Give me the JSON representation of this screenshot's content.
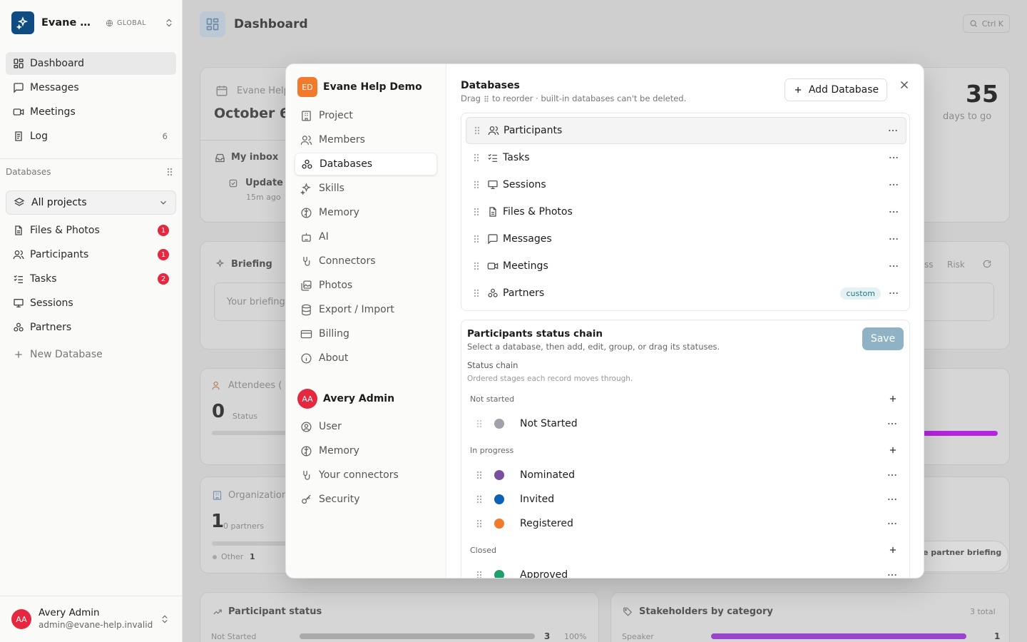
{
  "workspace": {
    "name": "Evane Help Demo",
    "scope": "GLOBAL"
  },
  "sidebar": {
    "nav": [
      {
        "label": "Dashboard"
      },
      {
        "label": "Messages"
      },
      {
        "label": "Meetings"
      },
      {
        "label": "Log",
        "count": "6"
      }
    ],
    "section_label": "Databases",
    "project_select": "All projects",
    "databases": [
      {
        "label": "Files & Photos",
        "badge": "1"
      },
      {
        "label": "Participants",
        "badge": "1"
      },
      {
        "label": "Tasks",
        "badge": "2"
      },
      {
        "label": "Sessions"
      },
      {
        "label": "Partners"
      }
    ],
    "new_database": "New Database"
  },
  "user": {
    "initials": "AA",
    "name": "Avery Admin",
    "email": "admin@evane-help.invalid"
  },
  "page": {
    "title": "Dashboard",
    "shortcut": "Ctrl K"
  },
  "background": {
    "event_name": "Evane Help",
    "event_date": "October 6",
    "days_count": "35",
    "days_label": "days to go",
    "inbox_title": "My inbox",
    "inbox_item": "Update",
    "inbox_time": "15m ago",
    "briefing_title": "Briefing",
    "briefing_text": "Your briefing",
    "briefing_tab_1": "ss",
    "briefing_tab_2": "Risk",
    "attendees_title": "Attendees (",
    "attendees_count": "0",
    "attendees_status": "Status",
    "org_title": "Organization",
    "org_count": "1",
    "org_sub": "0 partners",
    "org_legend": "Other",
    "org_legend_count": "1",
    "partner_btn": "e partner briefing",
    "participant_status_title": "Participant status",
    "ps_row_label": "Not Started",
    "ps_row_count": "3",
    "ps_row_pct": "100%",
    "stakeholders_title": "Stakeholders by category",
    "stakeholders_total": "3 total",
    "sh_row_label": "Speaker",
    "sh_row_count": "1"
  },
  "modal": {
    "project": {
      "initials": "ED",
      "name": "Evane Help Demo"
    },
    "project_nav": [
      "Project",
      "Members",
      "Databases",
      "Skills",
      "Memory",
      "AI",
      "Connectors",
      "Photos",
      "Export / Import",
      "Billing",
      "About"
    ],
    "user_nav": [
      "User",
      "Memory",
      "Your connectors",
      "Security"
    ],
    "databases": {
      "title": "Databases",
      "subtitle_pre": "Drag",
      "subtitle_post": "to reorder · built-in databases can't be deleted.",
      "add_label": "Add Database",
      "items": [
        {
          "label": "Participants"
        },
        {
          "label": "Tasks"
        },
        {
          "label": "Sessions"
        },
        {
          "label": "Files & Photos"
        },
        {
          "label": "Messages"
        },
        {
          "label": "Meetings"
        },
        {
          "label": "Partners",
          "tag": "custom"
        }
      ]
    },
    "chain": {
      "title": "Participants status chain",
      "subtitle": "Select a database, then add, edit, group, or drag its statuses.",
      "save_label": "Save",
      "section_label": "Status chain",
      "section_sub": "Ordered stages each record moves through.",
      "groups": [
        "Not started",
        "In progress",
        "Closed"
      ],
      "statuses": [
        {
          "label": "Not Started",
          "color": "#a1a1aa"
        },
        {
          "label": "Nominated",
          "color": "#7b4fa0"
        },
        {
          "label": "Invited",
          "color": "#0b63b6"
        },
        {
          "label": "Registered",
          "color": "#f27a2c"
        },
        {
          "label": "Approved",
          "color": "#1e9e6a"
        }
      ]
    }
  },
  "colors": {
    "accent": "#0f4c81",
    "badge": "#e5283f",
    "project_avatar": "#f27a2c",
    "save_disabled": "#8fb3c4",
    "progress_bar": "#b524e0"
  }
}
